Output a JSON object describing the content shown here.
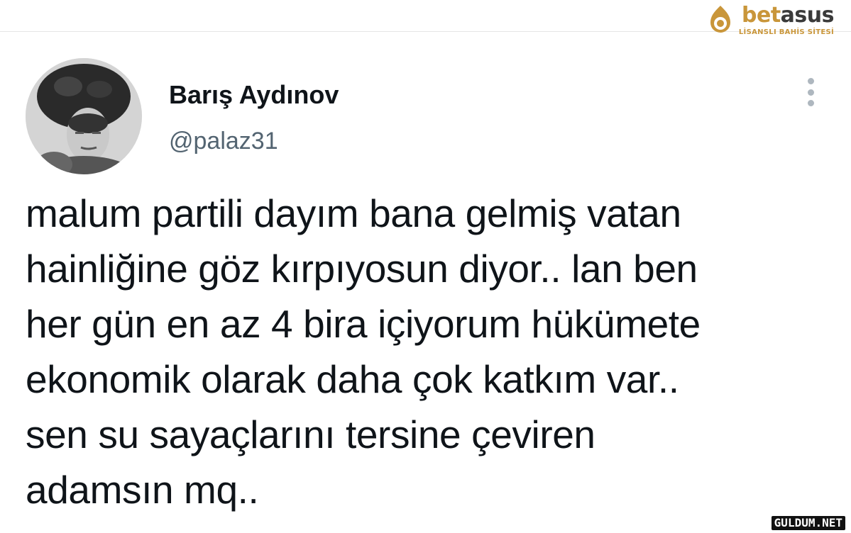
{
  "brand": {
    "name_part1": "bet",
    "name_part2": "asus",
    "tagline": "LİSANSLI BAHİS SİTESİ",
    "gold": "#c9963a",
    "dark": "#3a3a3a"
  },
  "tweet": {
    "display_name": "Barış Aydınov",
    "handle": "@palaz31",
    "more_icon": "more-vertical-icon",
    "lines": [
      "malum partili dayım bana gelmiş vatan",
      "hainliğine göz kırpıyosun diyor.. lan ben",
      "her gün en az 4 bira içiyorum hükümete",
      "ekonomik olarak daha çok katkım var..",
      "sen su sayaçlarını tersine çeviren",
      "adamsın mq.."
    ]
  },
  "watermark": {
    "text": "GULDUM.NET"
  }
}
